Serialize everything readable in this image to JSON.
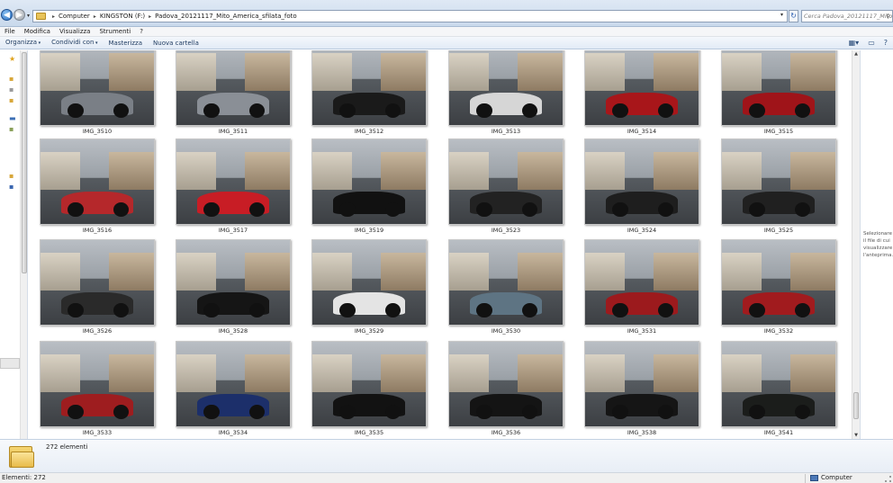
{
  "window": {
    "address_crumbs": [
      "Computer",
      "KINGSTON (F:)",
      "Padova_20121117_Mito_America_sfilata_foto"
    ],
    "search_placeholder": "Cerca Padova_20121117_Mito..."
  },
  "menu": [
    "File",
    "Modifica",
    "Visualizza",
    "Strumenti",
    "?"
  ],
  "commands": [
    {
      "label": "Organizza",
      "dropdown": true
    },
    {
      "label": "Condividi con",
      "dropdown": true
    },
    {
      "label": "Masterizza",
      "dropdown": false
    },
    {
      "label": "Nuova cartella",
      "dropdown": false
    }
  ],
  "files": [
    {
      "name": "IMG_3510",
      "car": "#7a7f86",
      "bg": "#8b9096"
    },
    {
      "name": "IMG_3511",
      "car": "#8a8f96",
      "bg": "#9aa0a6"
    },
    {
      "name": "IMG_3512",
      "car": "#1a1a1a",
      "bg": "#9aa0a6"
    },
    {
      "name": "IMG_3513",
      "car": "#d6d6d6",
      "bg": "#8d9298"
    },
    {
      "name": "IMG_3514",
      "car": "#a8161a",
      "bg": "#a9adb2"
    },
    {
      "name": "IMG_3515",
      "car": "#9f1419",
      "bg": "#a9adb2"
    },
    {
      "name": "IMG_3516",
      "car": "#b5282b",
      "bg": "#b5a58f"
    },
    {
      "name": "IMG_3517",
      "car": "#c81d25",
      "bg": "#8e8a84"
    },
    {
      "name": "IMG_3519",
      "car": "#111111",
      "bg": "#e6e6e6"
    },
    {
      "name": "IMG_3523",
      "car": "#222222",
      "bg": "#9ea3a8"
    },
    {
      "name": "IMG_3524",
      "car": "#1e1e1e",
      "bg": "#a2a6ab"
    },
    {
      "name": "IMG_3525",
      "car": "#202020",
      "bg": "#b9bcc0"
    },
    {
      "name": "IMG_3526",
      "car": "#2a2a2a",
      "bg": "#9fa3a8"
    },
    {
      "name": "IMG_3528",
      "car": "#151515",
      "bg": "#a3a7ac"
    },
    {
      "name": "IMG_3529",
      "car": "#e4e4e4",
      "bg": "#a3a7ac"
    },
    {
      "name": "IMG_3530",
      "car": "#5e7483",
      "bg": "#a3a7ac"
    },
    {
      "name": "IMG_3531",
      "car": "#9c1a1d",
      "bg": "#a3a7ac"
    },
    {
      "name": "IMG_3532",
      "car": "#a11b1e",
      "bg": "#a3a7ac"
    },
    {
      "name": "IMG_3533",
      "car": "#9e1d1f",
      "bg": "#a3a7ac"
    },
    {
      "name": "IMG_3534",
      "car": "#1c2f6a",
      "bg": "#8f9398"
    },
    {
      "name": "IMG_3535",
      "car": "#121212",
      "bg": "#989ca1"
    },
    {
      "name": "IMG_3536",
      "car": "#141414",
      "bg": "#999da2"
    },
    {
      "name": "IMG_3538",
      "car": "#151515",
      "bg": "#9da1a6"
    },
    {
      "name": "IMG_3541",
      "car": "#1b1d1b",
      "bg": "#9da1a6"
    }
  ],
  "preview_hint": "Selezionare il file di cui visualizzare l'anteprima.",
  "details": {
    "count": "272 elementi"
  },
  "status": {
    "left": "Elementi: 272",
    "right": "Computer"
  }
}
